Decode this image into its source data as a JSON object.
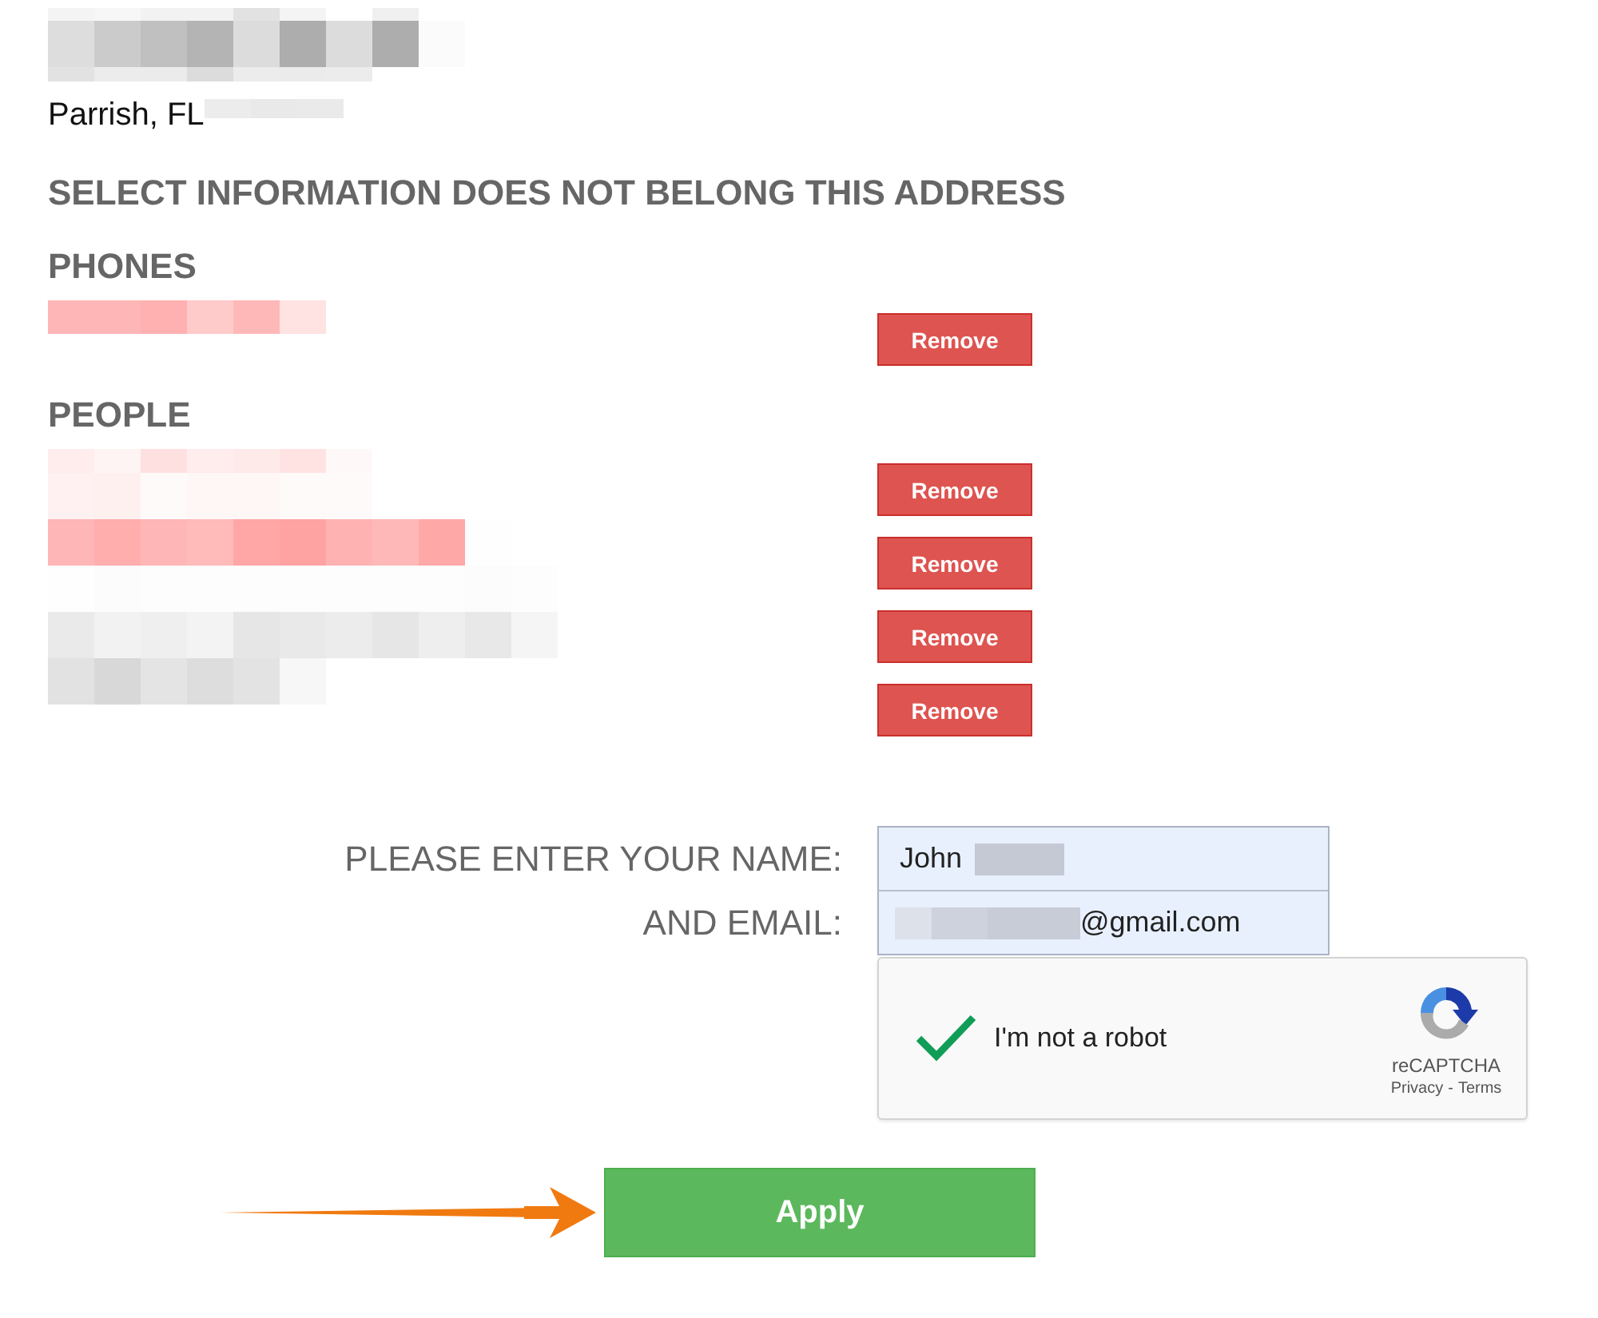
{
  "location": {
    "city": "Parrish, FL"
  },
  "heading": "SELECT INFORMATION DOES NOT BELONG THIS ADDRESS",
  "sections": [
    {
      "title": "PHONES",
      "rows": [
        {
          "button": "Remove"
        }
      ]
    },
    {
      "title": "PEOPLE",
      "rows": [
        {
          "button": "Remove"
        },
        {
          "button": "Remove"
        },
        {
          "button": "Remove"
        },
        {
          "button": "Remove"
        }
      ]
    }
  ],
  "form": {
    "name_label": "PLEASE ENTER YOUR NAME:",
    "name_value": "John",
    "email_label": "AND EMAIL:",
    "email_value": "@gmail.com"
  },
  "captcha": {
    "label": "I'm not a robot",
    "checked": true,
    "brand": "reCAPTCHA",
    "links": [
      "Privacy",
      "Terms"
    ],
    "separator": "-"
  },
  "submit": "Apply"
}
